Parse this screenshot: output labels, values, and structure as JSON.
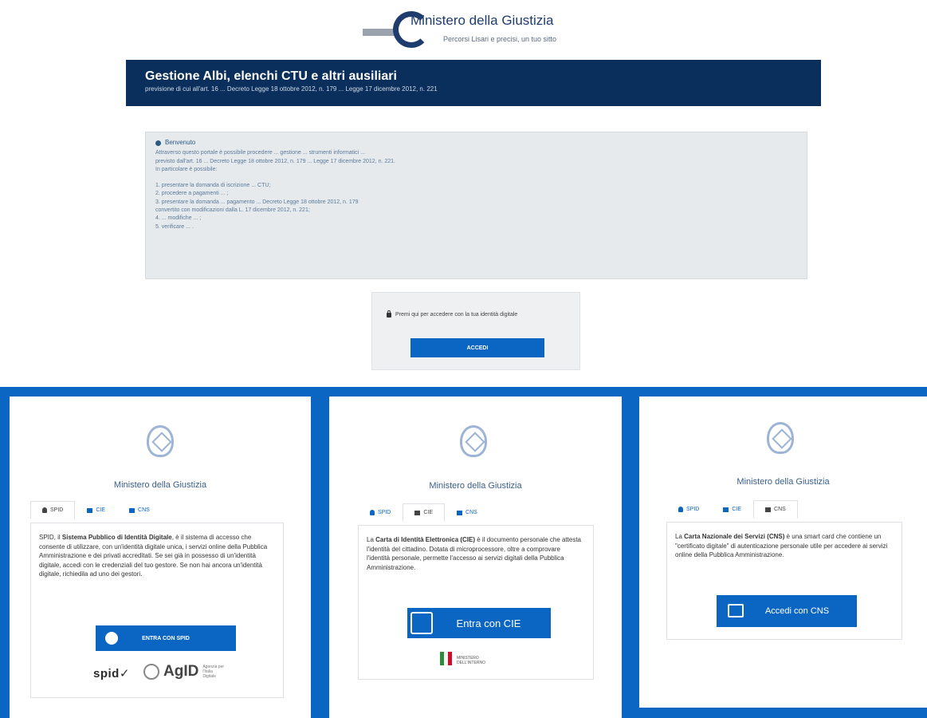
{
  "header": {
    "logo_title": "Ministero della Giustizia",
    "logo_sub": "Percorsi Lisari e precisi, un tuo sitto"
  },
  "banner": {
    "title": "Gestione Albi, elenchi CTU e altri ausiliari",
    "subtitle": "previsione di cui all'art. 16 ... Decreto Legge 18 ottobre 2012, n. 179 ... Legge 17 dicembre 2012, n. 221"
  },
  "info": {
    "heading": "Benvenuto",
    "paragraph_lines": [
      "Attraverso questo portale è possibile procedere ... gestione ... strumenti informatici ...",
      "previsto dall'art. 16 ... Decreto Legge 18 ottobre 2012, n. 179 ... Legge 17 dicembre 2012, n. 221.",
      "In particolare è possibile:"
    ],
    "list": [
      "1. presentare la domanda di iscrizione ... CTU;",
      "2. procedere a pagamenti ... ;",
      "3. presentare la domanda ... pagamento ... Decreto Legge 18 ottobre 2012, n. 179",
      "convertito con modificazioni dalla L. 17 dicembre 2012, n. 221;",
      "4. ... modifiche ... ;",
      "5. verificare ... ."
    ]
  },
  "login": {
    "prompt": "Premi qui per accedere con la tua identità digitale",
    "button": "ACCEDI"
  },
  "panels": [
    {
      "ministry": "Ministero della Giustizia",
      "tabs": [
        "SPID",
        "CIE",
        "CNS"
      ],
      "active_tab": 0,
      "text_before": "SPID, il ",
      "text_bold": "Sistema Pubblico di Identità Digitale",
      "text_after": ", è il sistema di accesso che consente di utilizzare, con un'identità digitale unica, i servizi online della Pubblica Amministrazione e dei privati accreditati. Se sei già in possesso di un'identità digitale, accedi con le credenziali del tuo gestore. Se non hai ancora un'identità digitale, richiedila ad uno dei gestori.",
      "button": "ENTRA CON SPID",
      "logo_spid": "spid✓",
      "logo_agid": "AgID",
      "logo_agid_small": "Agenzia per l'Italia Digitale"
    },
    {
      "ministry": "Ministero della Giustizia",
      "tabs": [
        "SPID",
        "CIE",
        "CNS"
      ],
      "active_tab": 1,
      "text_before": "La ",
      "text_bold": "Carta di Identità Elettronica (CIE)",
      "text_after": " è il documento personale che attesta l'identità del cittadino. Dotata di microprocessore, oltre a comprovare l'identità personale, permette l'accesso ai servizi digitali della Pubblica Amministrazione.",
      "button": "Entra con CIE",
      "footer_caption": "MINISTERO DELL'INTERNO"
    },
    {
      "ministry": "Ministero della Giustizia",
      "tabs": [
        "SPID",
        "CIE",
        "CNS"
      ],
      "active_tab": 2,
      "text_before": "La ",
      "text_bold": "Carta Nazionale dei Servizi (CNS)",
      "text_after": " è una smart card che contiene un \"certificato digitale\" di autenticazione personale utile per accedere ai servizi online della Pubblica Amministrazione.",
      "button": "Accedi con CNS"
    }
  ],
  "colors": {
    "banner_bg": "#0a2f5c",
    "brand_blue": "#0b66c3",
    "info_bg": "#e7eaed"
  }
}
